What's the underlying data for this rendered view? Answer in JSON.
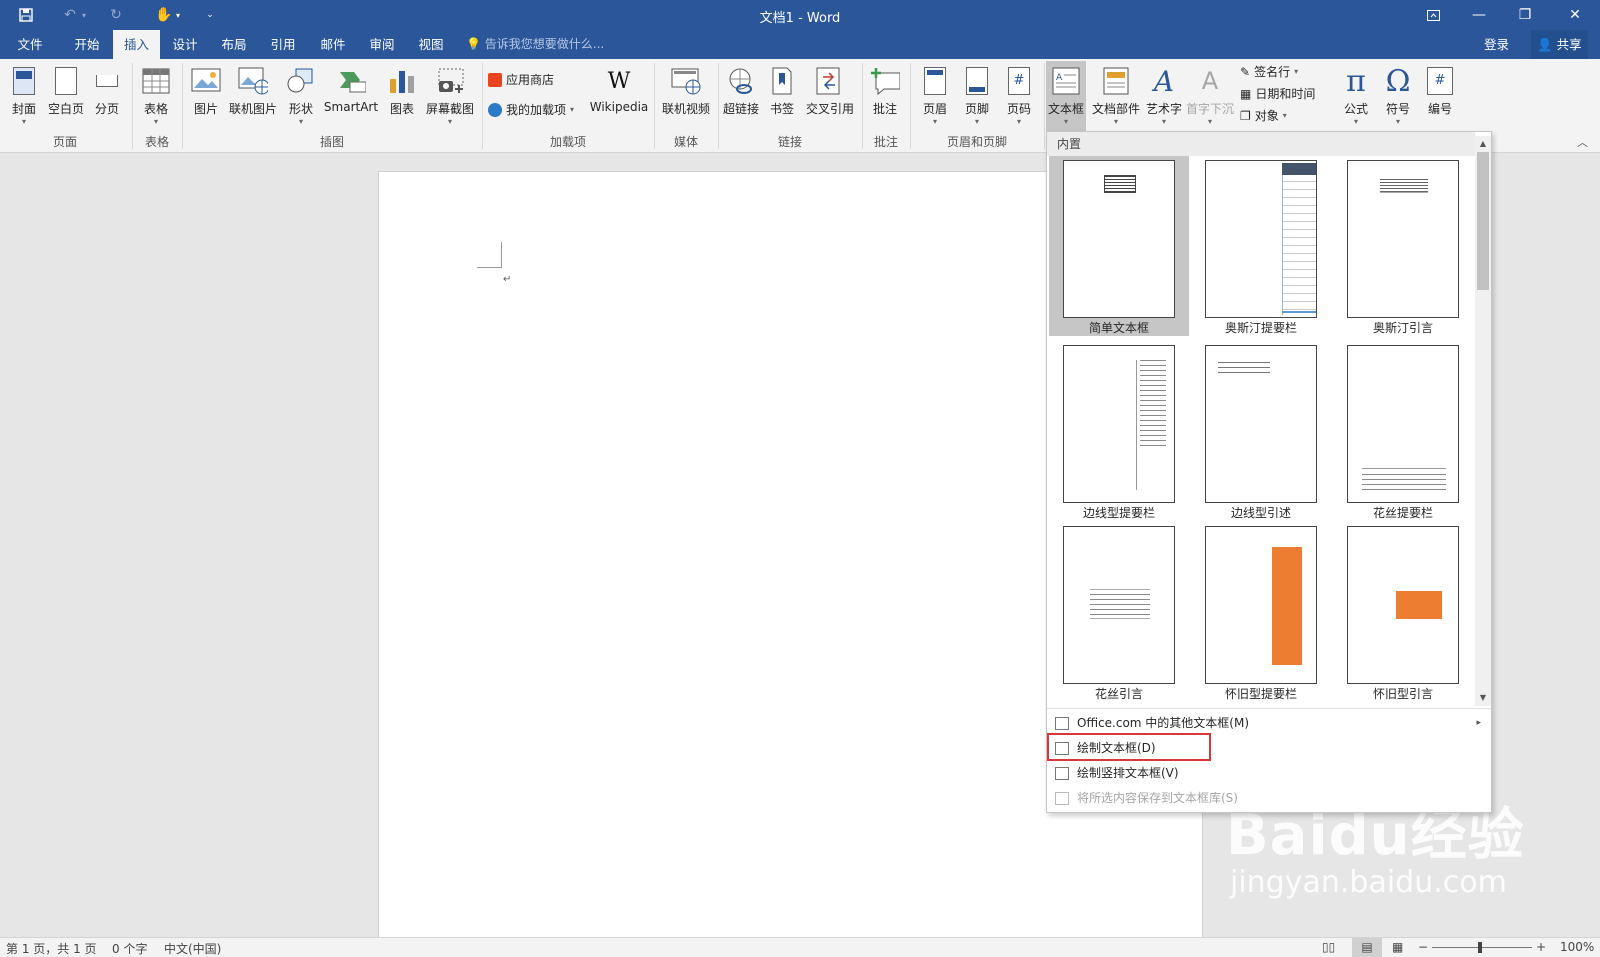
{
  "window": {
    "title": "文档1 - Word"
  },
  "qat": {
    "save_icon": "save-icon",
    "undo_icon": "undo-icon",
    "redo_icon": "redo-icon",
    "touch_icon": "touch-mode-icon",
    "customize_icon": "customize-icon"
  },
  "menu": {
    "tabs": [
      "文件",
      "开始",
      "插入",
      "设计",
      "布局",
      "引用",
      "邮件",
      "审阅",
      "视图"
    ],
    "active_tab": "插入",
    "tell_me": "告诉我您想要做什么...",
    "login": "登录",
    "share": "共享"
  },
  "ribbon": {
    "buttons": [
      "封面",
      "空白页",
      "分页",
      "表格",
      "图片",
      "联机图片",
      "形状",
      "SmartArt",
      "图表",
      "屏幕截图",
      "Wikipedia",
      "联机视频",
      "超链接",
      "书签",
      "交叉引用",
      "批注",
      "页眉",
      "页脚",
      "页码",
      "文本框",
      "文档部件",
      "艺术字",
      "首字下沉",
      "公式",
      "符号",
      "编号"
    ],
    "addins": {
      "store": "应用商店",
      "my_addins": "我的加载项"
    },
    "text_small": {
      "signature": "签名行",
      "datetime": "日期和时间",
      "object": "对象"
    },
    "groups": [
      "页面",
      "表格",
      "插图",
      "加载项",
      "媒体",
      "链接",
      "批注",
      "页眉和页脚"
    ]
  },
  "dropdown": {
    "header": "内置",
    "thumbnails": [
      "简单文本框",
      "奥斯汀提要栏",
      "奥斯汀引言",
      "边线型提要栏",
      "边线型引述",
      "花丝提要栏",
      "花丝引言",
      "怀旧型提要栏",
      "怀旧型引言"
    ],
    "selected": "简单文本框",
    "items": [
      {
        "label": "Office.com 中的其他文本框(M)",
        "disabled": false
      },
      {
        "label": "绘制文本框(D)",
        "disabled": false
      },
      {
        "label": "绘制竖排文本框(V)",
        "disabled": false
      },
      {
        "label": "将所选内容保存到文本框库(S)",
        "disabled": true
      }
    ],
    "accent_orange": "#ed7d31",
    "accent_navy": "#44546a"
  },
  "status": {
    "page": "第 1 页，共 1 页",
    "words": "0 个字",
    "lang": "中文(中国)",
    "zoom": "100%"
  },
  "watermark": {
    "main": "Baidu经验",
    "sub": "jingyan.baidu.com"
  },
  "colors": {
    "brand": "#2b579a",
    "highlight": "#d9383a"
  }
}
